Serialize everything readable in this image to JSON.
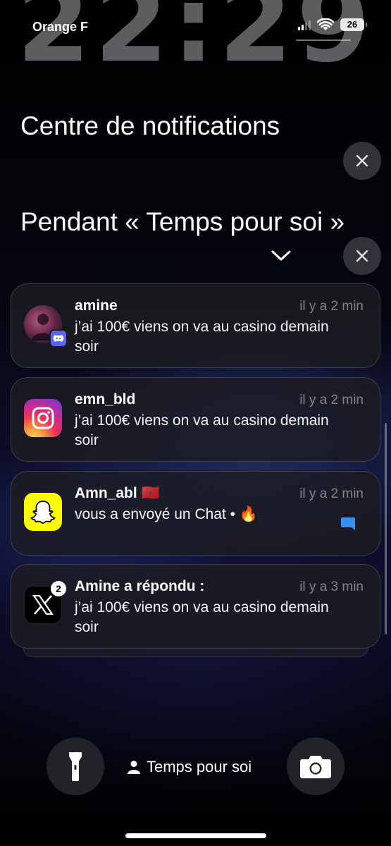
{
  "lockscreen": {
    "clock": "22:29"
  },
  "status_bar": {
    "carrier": "Orange F",
    "battery": "26"
  },
  "notification_center": {
    "title": "Centre de notifications",
    "focus_section_title": "Pendant « Temps pour soi »"
  },
  "notifications": [
    {
      "app": "Discord",
      "sender": "amine",
      "time": "il y a 2 min",
      "body": "j’ai 100€ viens on va au casino demain soir"
    },
    {
      "app": "Instagram",
      "sender": "emn_bld",
      "time": "il y a 2 min",
      "body": "j’ai 100€ viens on va au casino demain soir"
    },
    {
      "app": "Snapchat",
      "sender": "Amn_abl 🇲🇦",
      "time": "il y a 2 min",
      "body": "vous a envoyé un Chat • 🔥"
    },
    {
      "app": "X",
      "sender": "Amine a répondu :",
      "time": "il y a 3 min",
      "body": "j’ai 100€ viens on va au casino demain soir",
      "badge": "2"
    }
  ],
  "bottom_bar": {
    "focus_label": "Temps pour soi"
  },
  "colors": {
    "discord": "#5865F2",
    "snapchat": "#FFFC00",
    "chat_blue": "#3a8ff5"
  }
}
